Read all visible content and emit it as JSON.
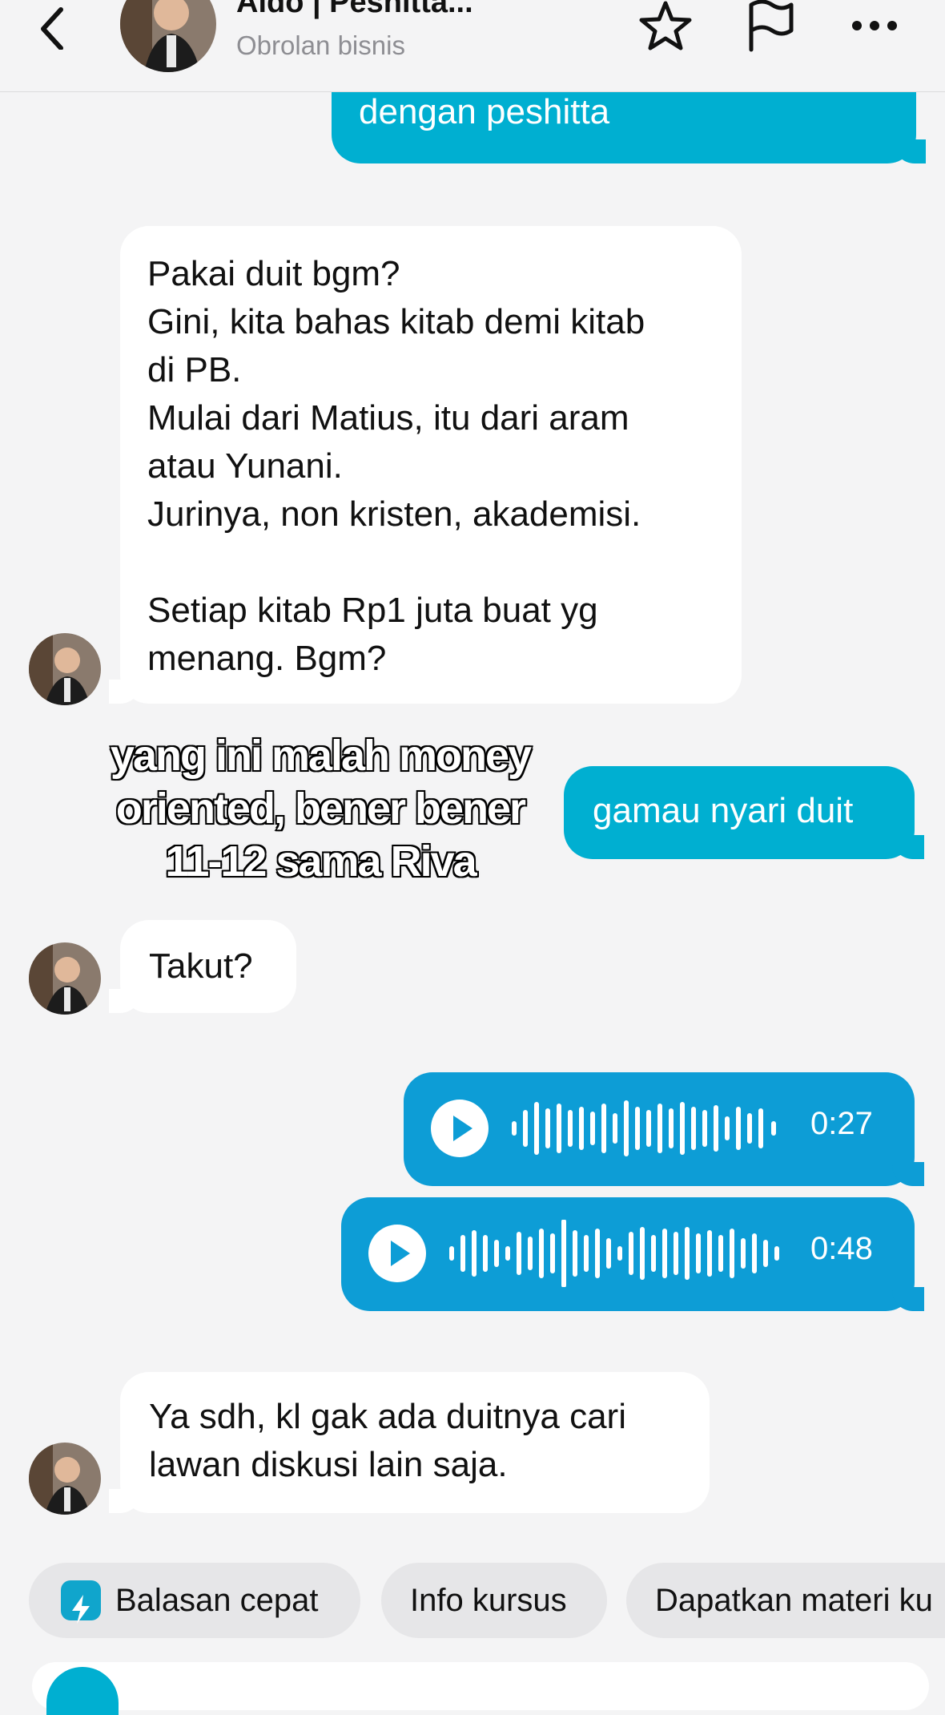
{
  "header": {
    "title": "Aldo | Peshitta...",
    "subtitle": "Obrolan bisnis"
  },
  "messages": {
    "m1": {
      "direction": "out",
      "text": "dengan peshitta"
    },
    "m2": {
      "direction": "in",
      "lines": [
        "Pakai duit bgm?",
        "Gini, kita bahas kitab demi kitab",
        "di PB.",
        "Mulai dari Matius, itu dari aram",
        "atau Yunani.",
        "Jurinya, non kristen, akademisi.",
        "",
        "Setiap kitab Rp1 juta buat yg",
        "menang. Bgm?"
      ]
    },
    "m3": {
      "direction": "out",
      "text": "gamau nyari duit"
    },
    "m4": {
      "direction": "in",
      "text": "Takut?"
    },
    "m5": {
      "direction": "out",
      "type": "voice",
      "duration": "0:27"
    },
    "m6": {
      "direction": "out",
      "type": "voice",
      "duration": "0:48"
    },
    "m7": {
      "direction": "in",
      "lines": [
        "Ya sdh, kl gak ada duitnya cari",
        "lawan diskusi lain saja."
      ]
    }
  },
  "overlay": {
    "lines": [
      "yang ini malah money",
      "oriented, bener bener",
      "11-12 sama Riva"
    ]
  },
  "quick_replies": {
    "items": [
      "Balasan cepat",
      "Info kursus",
      "Dapatkan materi ku"
    ]
  },
  "colors": {
    "outgoing": "#00afd1",
    "voice": "#0d9dd6",
    "background": "#f4f4f5"
  }
}
